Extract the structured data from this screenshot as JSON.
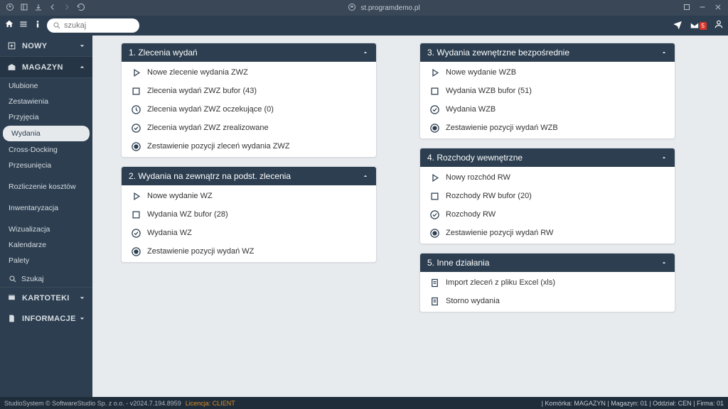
{
  "titlebar": {
    "url": "st.programdemo.pl"
  },
  "toolbar": {
    "search_placeholder": "szukaj",
    "mail_badge": "5"
  },
  "sidebar": {
    "sections": {
      "nowy": "NOWY",
      "magazyn": "MAGAZYN",
      "kartoteki": "KARTOTEKI",
      "informacje": "INFORMACJE"
    },
    "magazyn_items": [
      "Ulubione",
      "Zestawienia",
      "Przyjęcia",
      "Wydania",
      "Cross-Docking",
      "Przesunięcia",
      "Rozliczenie kosztów",
      "Inwentaryzacja",
      "Wizualizacja",
      "Kalendarze",
      "Palety",
      "Szukaj"
    ],
    "active_index": 3
  },
  "cards": [
    {
      "title": "1. Zlecenia wydań",
      "items": [
        {
          "icon": "play",
          "label": "Nowe zlecenie wydania ZWZ"
        },
        {
          "icon": "square",
          "label": "Zlecenia wydań ZWZ bufor (43)"
        },
        {
          "icon": "clock",
          "label": "Zlecenia wydań ZWZ oczekujące (0)"
        },
        {
          "icon": "check",
          "label": "Zlecenia wydań ZWZ zrealizowane"
        },
        {
          "icon": "radio",
          "label": "Zestawienie pozycji zleceń wydania ZWZ"
        }
      ]
    },
    {
      "title": "2. Wydania na zewnątrz na podst. zlecenia",
      "items": [
        {
          "icon": "play",
          "label": "Nowe wydanie WZ"
        },
        {
          "icon": "square",
          "label": "Wydania WZ bufor (28)"
        },
        {
          "icon": "check",
          "label": "Wydania WZ"
        },
        {
          "icon": "radio",
          "label": "Zestawienie pozycji wydań WZ"
        }
      ]
    },
    {
      "title": "3. Wydania zewnętrzne bezpośrednie",
      "items": [
        {
          "icon": "play",
          "label": "Nowe wydanie WZB"
        },
        {
          "icon": "square",
          "label": "Wydania WZB bufor (51)"
        },
        {
          "icon": "check",
          "label": "Wydania WZB"
        },
        {
          "icon": "radio",
          "label": "Zestawienie pozycji wydań WZB"
        }
      ]
    },
    {
      "title": "4. Rozchody wewnętrzne",
      "items": [
        {
          "icon": "play",
          "label": "Nowy rozchód RW"
        },
        {
          "icon": "square",
          "label": "Rozchody RW bufor (20)"
        },
        {
          "icon": "check",
          "label": "Rozchody RW"
        },
        {
          "icon": "radio",
          "label": "Zestawienie pozycji wydań RW"
        }
      ]
    },
    {
      "title": "5. Inne działania",
      "items": [
        {
          "icon": "doc",
          "label": "Import zleceń z pliku Excel (xls)"
        },
        {
          "icon": "doc",
          "label": "Storno wydania"
        }
      ]
    }
  ],
  "status": {
    "copyright": "StudioSystem © SoftwareStudio Sp. z o.o. - v2024.7.194.8959",
    "license": "Licencja: CLIENT",
    "right": "| Komórka: MAGAZYN | Magazyn: 01 | Oddział: CEN | Firma: 01"
  }
}
